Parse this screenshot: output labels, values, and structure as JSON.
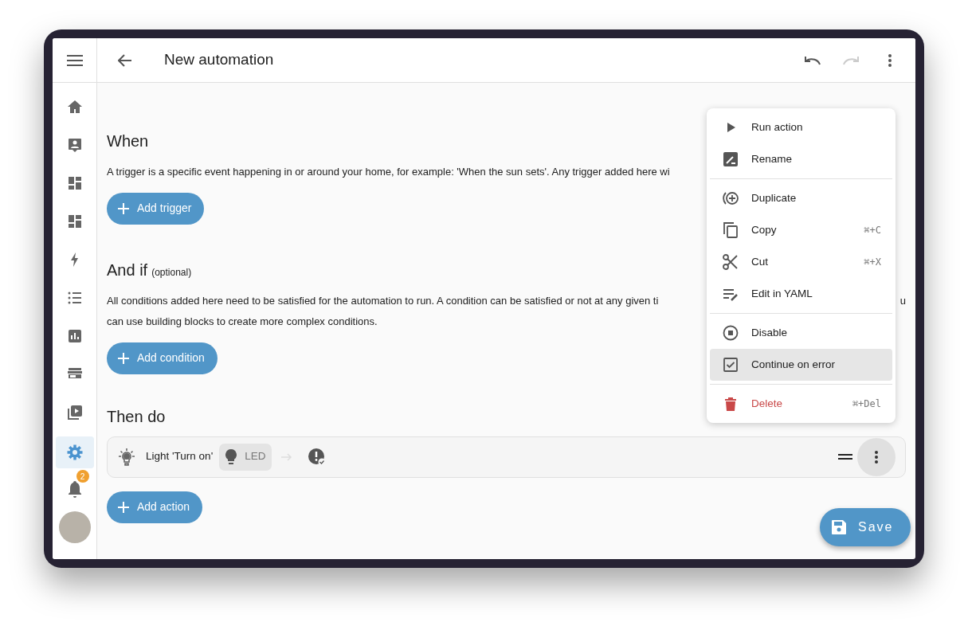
{
  "header": {
    "title": "New automation",
    "undo_disabled": false,
    "redo_disabled": true
  },
  "sidebar": {
    "items": [
      {
        "selected": false
      },
      {
        "selected": false
      },
      {
        "selected": false
      },
      {
        "selected": false
      },
      {
        "selected": false
      },
      {
        "selected": false
      },
      {
        "selected": false
      },
      {
        "selected": false
      },
      {
        "selected": false
      },
      {
        "selected": true
      }
    ],
    "notifications_badge": "2"
  },
  "sections": [
    {
      "title": "When",
      "lines": [
        "A trigger is a specific event happening in or around your home, for example: 'When the sun sets'. Any trigger added here wi"
      ],
      "button": "Add trigger"
    },
    {
      "title": "And if",
      "optional": "(optional)",
      "lines": [
        "All conditions added here need to be satisfied for the automation to run. A condition can be satisfied or not at any given ti",
        "can use building blocks to create more complex conditions."
      ],
      "after_menu": "u",
      "button": "Add condition"
    },
    {
      "title": "Then do"
    }
  ],
  "action_row": {
    "label": "Light 'Turn on'",
    "target": "LED",
    "menu_open": true
  },
  "add_action": "Add action",
  "menu": [
    {
      "kind": "item",
      "label": "Run action",
      "highlighted": false,
      "danger": false
    },
    {
      "kind": "item",
      "label": "Rename",
      "highlighted": false,
      "danger": false
    },
    {
      "kind": "divider"
    },
    {
      "kind": "item",
      "label": "Duplicate",
      "highlighted": false,
      "danger": false
    },
    {
      "kind": "item",
      "label": "Copy",
      "shortcut": "⌘+C",
      "highlighted": false,
      "danger": false
    },
    {
      "kind": "item",
      "label": "Cut",
      "shortcut": "⌘+X",
      "highlighted": false,
      "danger": false
    },
    {
      "kind": "item",
      "label": "Edit in YAML",
      "highlighted": false,
      "danger": false
    },
    {
      "kind": "divider"
    },
    {
      "kind": "item",
      "label": "Disable",
      "highlighted": false,
      "danger": false
    },
    {
      "kind": "item",
      "label": "Continue on error",
      "highlighted": true,
      "danger": false
    },
    {
      "kind": "divider"
    },
    {
      "kind": "item",
      "label": "Delete",
      "shortcut": "⌘+Del",
      "highlighted": false,
      "danger": true
    }
  ],
  "save_button": "Save"
}
